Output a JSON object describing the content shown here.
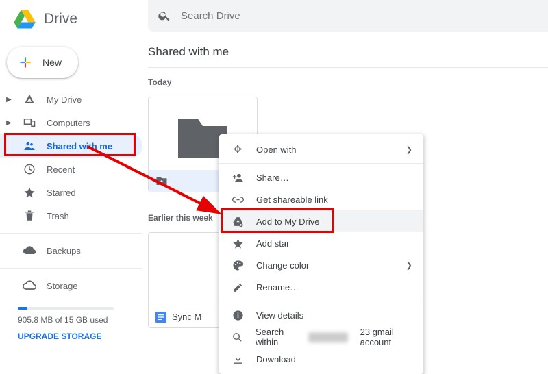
{
  "app": {
    "name": "Drive"
  },
  "search": {
    "placeholder": "Search Drive"
  },
  "newButton": {
    "label": "New"
  },
  "nav": {
    "myDrive": "My Drive",
    "computers": "Computers",
    "sharedWithMe": "Shared with me",
    "recent": "Recent",
    "starred": "Starred",
    "trash": "Trash",
    "backups": "Backups",
    "storage": "Storage"
  },
  "storage": {
    "usedText": "905.8 MB of 15 GB used",
    "upgradeText": "UPGRADE STORAGE"
  },
  "page": {
    "title": "Shared with me",
    "today": "Today",
    "earlier": "Earlier this week",
    "folderName": "",
    "syncName": "Sync M"
  },
  "menu": {
    "openWith": "Open with",
    "share": "Share…",
    "getLink": "Get shareable link",
    "addToDrive": "Add to My Drive",
    "addStar": "Add star",
    "changeColor": "Change color",
    "rename": "Rename…",
    "viewDetails": "View details",
    "searchWithin": "Search within",
    "searchAccountSuffix": "23 gmail account",
    "download": "Download"
  },
  "annotations": {
    "highlightSidebar": "Shared with me sidebar item",
    "highlightMenu": "Add to My Drive menu item",
    "arrow": "arrow from sidebar to menu"
  },
  "colors": {
    "accent": "#1a73e8",
    "highlight": "#e60000"
  }
}
